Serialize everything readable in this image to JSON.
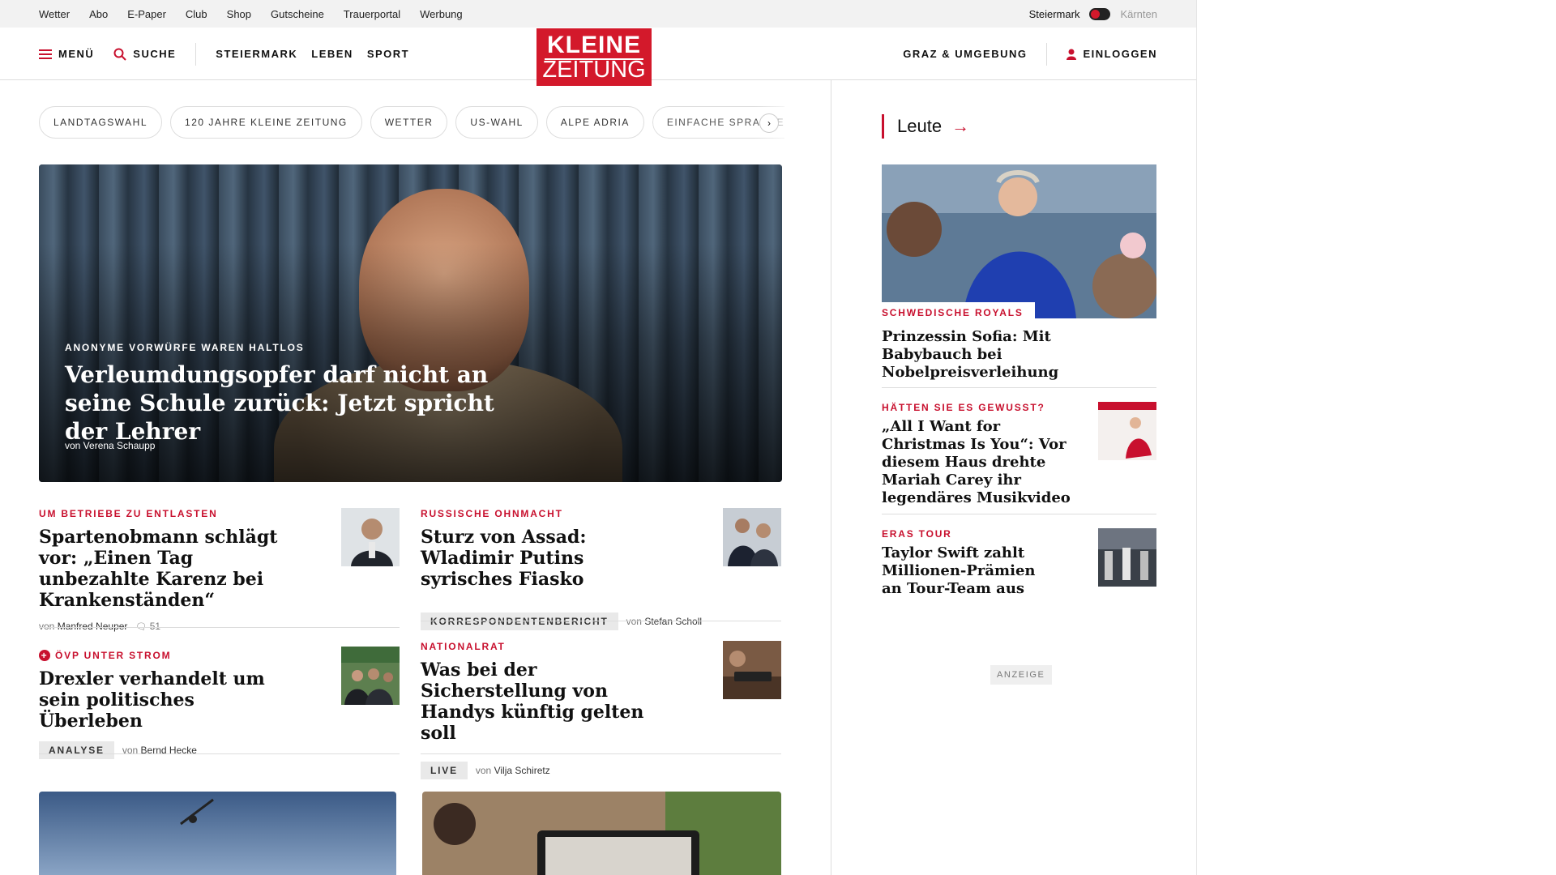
{
  "topbar": {
    "links": [
      "Wetter",
      "Abo",
      "E-Paper",
      "Club",
      "Shop",
      "Gutscheine",
      "Trauerportal",
      "Werbung"
    ],
    "region_active": "Steiermark",
    "region_inactive": "Kärnten"
  },
  "nav": {
    "menu": "MENÜ",
    "search": "SUCHE",
    "sections": [
      "STEIERMARK",
      "LEBEN",
      "SPORT"
    ],
    "local": "GRAZ & UMGEBUNG",
    "login": "EINLOGGEN"
  },
  "logo": {
    "line1": "KLEINE",
    "line2": "ZEITUNG"
  },
  "tags": [
    "LANDTAGSWAHL",
    "120 JAHRE KLEINE ZEITUNG",
    "WETTER",
    "US-WAHL",
    "ALPE ADRIA",
    "EINFACHE SPRACHE"
  ],
  "hero": {
    "kicker": "ANONYME VORWÜRFE WAREN HALTLOS",
    "title": "Verleumdungsopfer darf nicht an seine Schule zurück: Jetzt spricht der Lehrer",
    "byline": "von Verena Schaupp"
  },
  "stories": [
    {
      "kicker": "UM BETRIEBE ZU ENTLASTEN",
      "title": "Spartenobmann schlägt vor: „Einen Tag unbezahlte Karenz bei Krankenständen“",
      "von": "von",
      "author": "Manfred Neuper",
      "comments": "51"
    },
    {
      "kicker": "RUSSISCHE OHNMACHT",
      "title": "Sturz von Assad: Wladimir Putins syrisches Fiasko",
      "badge": "KORRESPONDENTENBERICHT",
      "von": "von",
      "author": "Stefan Scholl"
    },
    {
      "kicker": "ÖVP UNTER STROM",
      "title": "Drexler verhandelt um sein politisches Überleben",
      "badge": "ANALYSE",
      "von": "von",
      "author": "Bernd Hecke"
    },
    {
      "kicker": "NATIONALRAT",
      "title": "Was bei der Sicherstellung von Handys künftig gelten soll",
      "badge": "LIVE",
      "von": "von",
      "author": "Vilja Schiretz"
    }
  ],
  "sidebar": {
    "title": "Leute",
    "stories": [
      {
        "kicker": "SCHWEDISCHE ROYALS",
        "title": "Prinzessin Sofia: Mit Babybauch bei Nobelpreisverleihung"
      },
      {
        "kicker": "HÄTTEN SIE ES GEWUSST?",
        "title": "„All I Want for Christmas Is You“: Vor diesem Haus drehte Mariah Carey ihr legendäres Musikvideo"
      },
      {
        "kicker": "ERAS TOUR",
        "title": "Taylor Swift zahlt Millionen-Prämien an Tour-Team aus"
      }
    ],
    "ad_label": "ANZEIGE"
  },
  "colors": {
    "brand_red": "#d3192b",
    "kicker_red": "#c8102e"
  }
}
